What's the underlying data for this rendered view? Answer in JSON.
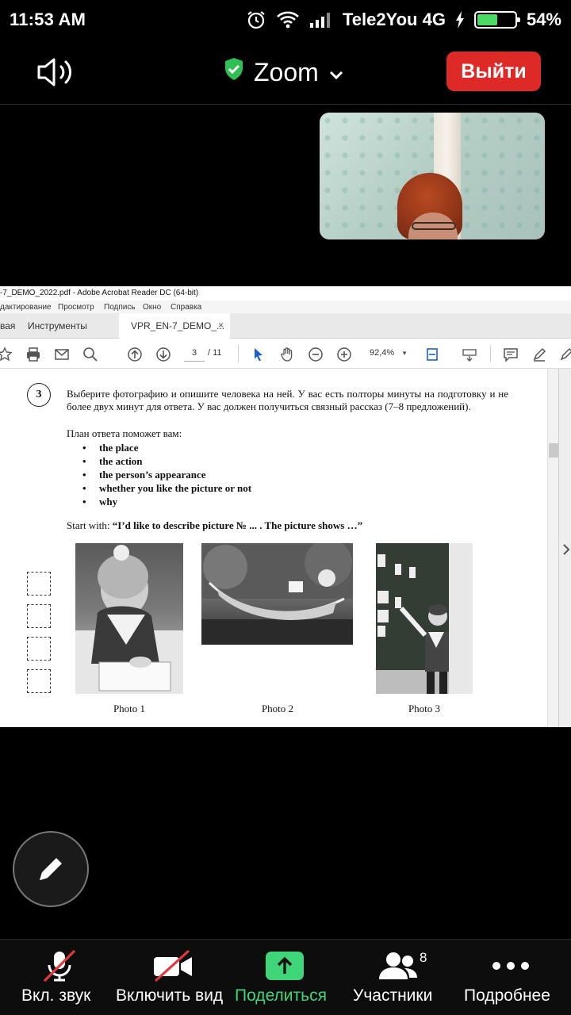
{
  "status_bar": {
    "time": "11:53 AM",
    "carrier": "Tele2You 4G",
    "battery": "54%",
    "battery_level": 0.54
  },
  "zoom_header": {
    "title": "Zoom",
    "leave_label": "Выйти",
    "colors": {
      "leave": "#dd2a27",
      "secure": "#2fbf55"
    }
  },
  "acrobat": {
    "window_title": "-7_DEMO_2022.pdf - Adobe Acrobat Reader DC (64-bit)",
    "menu": [
      "дактирование",
      "Просмотр",
      "Подпись",
      "Окно",
      "Справка"
    ],
    "tabs": [
      "вая",
      "Инструменты",
      "VPR_EN-7_DEMO_..."
    ],
    "tab_close": "×",
    "page_current": "3",
    "page_total": "/ 11",
    "zoom_value": "92,4%"
  },
  "document": {
    "question_number": "3",
    "question_text": "Выберите фотографию и опишите человека на ней. У вас есть полторы минуты на подготовку и не более двух минут для ответа. У вас должен получиться связный рассказ (7–8 предложений).",
    "plan_intro": "План ответа поможет вам:",
    "plan_items": [
      "the place",
      "the action",
      "the person’s appearance",
      "whether you like the picture or not",
      "why"
    ],
    "start_prefix": "Start with: ",
    "start_quote": "“I’d like to describe picture № ... . The picture shows …”",
    "photo_captions": [
      "Photo 1",
      "Photo 2",
      "Photo 3"
    ]
  },
  "bottom_bar": {
    "items": [
      {
        "label": "Вкл. звук",
        "icon": "mic-muted-icon"
      },
      {
        "label": "Включить вид",
        "icon": "video-off-icon"
      },
      {
        "label": "Поделиться",
        "icon": "share-icon"
      },
      {
        "label": "Участники",
        "icon": "participants-icon",
        "badge": "8"
      },
      {
        "label": "Подробнее",
        "icon": "more-icon"
      }
    ],
    "colors": {
      "share": "#3fd67a",
      "muted": "#e0373b"
    }
  }
}
